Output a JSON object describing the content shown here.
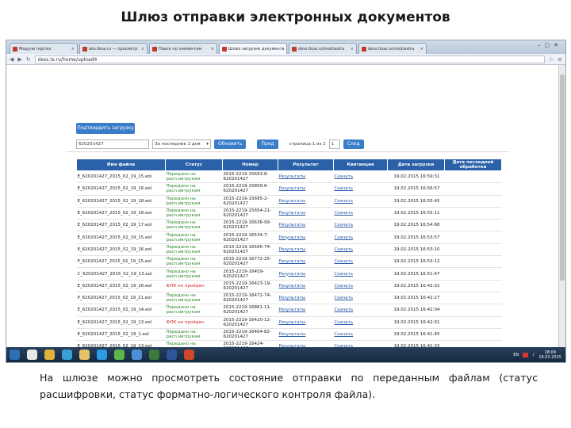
{
  "slide": {
    "title": "Шлюз отправки электронных документов",
    "caption": "На шлюзе можно просмотреть состояние отправки по переданным файлам (статус расшифровки, статус форматно-логического контроля файла)."
  },
  "browser": {
    "tabs": [
      "Модули портал",
      "ako.tkoa.ru — просмотр",
      "Поиск по элементам",
      "Шлюз загрузки документа",
      "dess.tkoa.ru/mod/extra",
      "dess.tkoa.ru/mod/extra"
    ],
    "url": "dess.ts.ru/home/upload4"
  },
  "page": {
    "confirm_button": "Подтвердить загрузку",
    "filter": {
      "number_value": "620201427",
      "period_value": "За последние 2 дня",
      "find_button": "Обновить",
      "prev_button": "Пред",
      "page_label": "страница 1 из 2",
      "page_value": "1",
      "next_button": "След"
    },
    "table": {
      "columns": [
        "Имя файла",
        "Статус",
        "Номер",
        "Результат",
        "Квитанция",
        "Дата загрузки",
        "Дата последней обработки"
      ],
      "rows": [
        {
          "file": "E_620201427_2015_02_19_15.eol",
          "status": "Передано на расп.ивтрукам",
          "err": false,
          "num": "2015-2219-15693-8-620201427",
          "result": "Результаты",
          "receipt": "Скачать",
          "date": "19.02.2015 16:59:31"
        },
        {
          "file": "E_620201427_2015_02_19_16.eol",
          "status": "Передано на расп.ивтрукам",
          "err": false,
          "num": "2015-2219-15859-6-620201427",
          "result": "Результаты",
          "receipt": "Скачать",
          "date": "19.02.2015 16:56:57"
        },
        {
          "file": "E_620201427_2015_02_19_18.eol",
          "status": "Передано на расп.ивтрукам",
          "err": false,
          "num": "2015-2219-15695-2-620201427",
          "result": "Результаты",
          "receipt": "Скачать",
          "date": "19.02.2015 16:55:45"
        },
        {
          "file": "E_620201427_2015_02_19_18.eol",
          "status": "Передано на расп.ивтрукам",
          "err": false,
          "num": "2015-2219-15654-21-620201427",
          "result": "Результаты",
          "receipt": "Скачать",
          "date": "19.02.2015 16:55:11"
        },
        {
          "file": "E_620201427_2015_02_19_17.eol",
          "status": "Передано на расп.ивтрукам",
          "err": false,
          "num": "2015-2219-16636-99-620201427",
          "result": "Результаты",
          "receipt": "Скачать",
          "date": "19.02.2015 16:54:68"
        },
        {
          "file": "E_620201427_2015_02_19_15.eol",
          "status": "Передано на расп.ивтрукам",
          "err": false,
          "num": "2015-2219-16534-7-620201427",
          "result": "Результаты",
          "receipt": "Скачать",
          "date": "19.02.2015 16:53:57"
        },
        {
          "file": "E_620201427_2015_02_19_16.eol",
          "status": "Передано на расп.ивтрукам",
          "err": false,
          "num": "2015-2219-16595-74-620201427",
          "result": "Результаты",
          "receipt": "Скачать",
          "date": "19.02.2015 16:53:10"
        },
        {
          "file": "P_620201427_2015_02_19_15.eol",
          "status": "Передано на расп.ивтрукам",
          "err": false,
          "num": "2015-2219-16772-25-620201427",
          "result": "Результаты",
          "receipt": "Скачать",
          "date": "19.02.2015 16:53:12"
        },
        {
          "file": "C_620201427_2015_02_19_13.eol",
          "status": "Передано на расп.ивтрукам",
          "err": false,
          "num": "2015-2219-16459-620201427",
          "result": "Результаты",
          "receipt": "Скачать",
          "date": "19.02.2015 16:51:47"
        },
        {
          "file": "E_620201427_2015_02_19_16.eol",
          "status": "ФЛК не пройден",
          "err": true,
          "num": "2015-2219-16423-19-620201427",
          "result": "Результаты",
          "receipt": "Скачать",
          "date": "19.02.2015 16:42:32"
        },
        {
          "file": "P_620201427_2015_02_19_21.eol",
          "status": "Передано на расп.ивтрукам",
          "err": false,
          "num": "2015-2219-16472-74-620201427",
          "result": "Результаты",
          "receipt": "Скачать",
          "date": "19.02.2015 16:42:27"
        },
        {
          "file": "E_620201427_2015_02_19_14.eol",
          "status": "Передано на расп.ивтрукам",
          "err": false,
          "num": "2015-2219-16881-11-620201427",
          "result": "Результаты",
          "receipt": "Скачать",
          "date": "19.02.2015 16:42:04"
        },
        {
          "file": "E_620201427_2015_02_19_13.eol",
          "status": "ФЛК не пройден",
          "err": true,
          "num": "2015-2219-16420-12-620201427",
          "result": "Результаты",
          "receipt": "Скачать",
          "date": "19.02.2015 16:42:01"
        },
        {
          "file": "E_620201427_2015_02_19_1.eol",
          "status": "Передано на расп.ивтрукам",
          "err": false,
          "num": "2015-2219-16404-82-620201427",
          "result": "Результаты",
          "receipt": "Скачать",
          "date": "19.02.2015 16:41:45"
        },
        {
          "file": "E_620201427_2015_02_19_13.eol",
          "status": "Передано на расп.ивтрукам",
          "err": false,
          "num": "2015-2219-16424-620201427",
          "result": "Результаты",
          "receipt": "Скачать",
          "date": "19.02.2015 16:41:33"
        },
        {
          "file": "E_620201427_2015_02_19_12.eol",
          "status": "Передано на расп.ивтрукам",
          "err": false,
          "num": "2015-2219-16411-99",
          "result": "Результаты",
          "receipt": "Скачать",
          "date": "19.02.2015 16:41:18"
        }
      ]
    }
  },
  "taskbar": {
    "icons": [
      {
        "name": "start-icon",
        "color": "#2f6fb6"
      },
      {
        "name": "media-icon",
        "color": "#e8e8e8"
      },
      {
        "name": "chrome-icon",
        "color": "#e0b03a"
      },
      {
        "name": "paint-icon",
        "color": "#3aa0d8"
      },
      {
        "name": "explorer-icon",
        "color": "#e6c36a"
      },
      {
        "name": "skype-icon",
        "color": "#2b9be3"
      },
      {
        "name": "chat-icon",
        "color": "#5db64d"
      },
      {
        "name": "network-icon",
        "color": "#4c8fd6"
      },
      {
        "name": "shield-icon",
        "color": "#3b7a3b"
      },
      {
        "name": "word-icon",
        "color": "#2b579a"
      },
      {
        "name": "powerpoint-icon",
        "color": "#d24726"
      }
    ],
    "lang": "EN",
    "time": "18:09",
    "date": "19.02.2015"
  }
}
